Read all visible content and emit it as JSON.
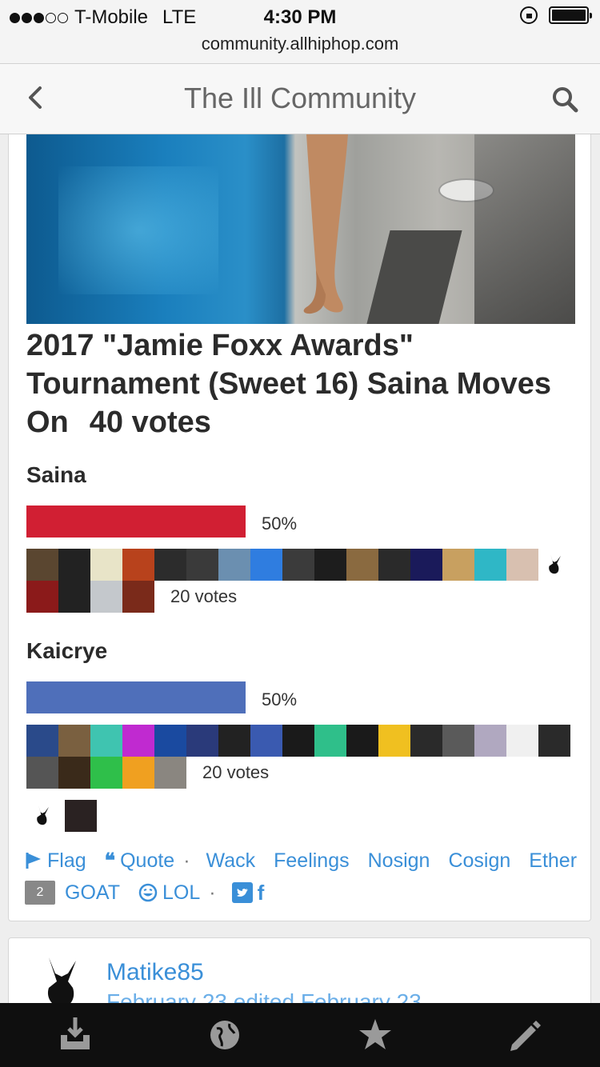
{
  "status": {
    "carrier": "T-Mobile",
    "network": "LTE",
    "time": "4:30 PM",
    "url": "community.allhiphop.com"
  },
  "header": {
    "title": "The Ill Community"
  },
  "post": {
    "title": "2017 \"Jamie Foxx Awards\" Tournament (Sweet 16) Saina Moves On",
    "total_votes": "40 votes",
    "options": [
      {
        "name": "Saina",
        "percent": "50%",
        "value": 0.5,
        "color": "#d11f33",
        "votes": "20 votes"
      },
      {
        "name": "Kaicrye",
        "percent": "50%",
        "value": 0.5,
        "color": "#4f6fba",
        "votes": "20 votes"
      }
    ]
  },
  "actions": {
    "flag": "Flag",
    "quote": "Quote",
    "wack": "Wack",
    "feelings": "Feelings",
    "nosign": "Nosign",
    "cosign": "Cosign",
    "ether": "Ether",
    "goat_count": "2",
    "goat": "GOAT",
    "lol": "LOL",
    "share_fb": "f"
  },
  "next_post": {
    "username": "Matike85",
    "date": "February 23 edited February 23"
  },
  "tabs": [
    "inbox-icon",
    "globe-icon",
    "star-icon",
    "pencil-icon"
  ]
}
